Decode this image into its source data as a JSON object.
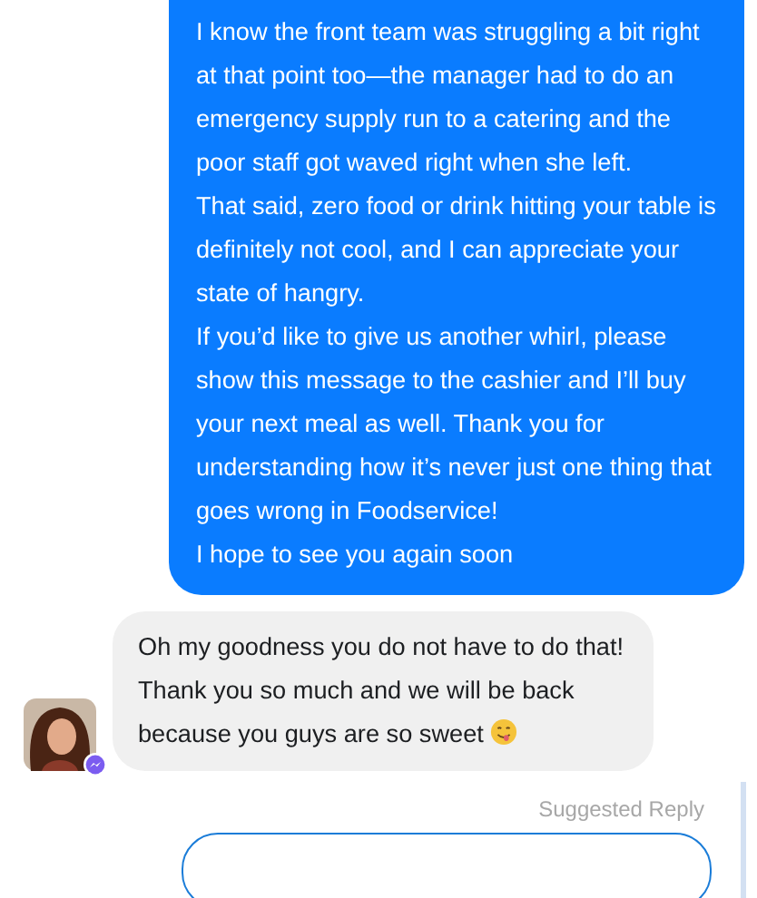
{
  "messages": [
    {
      "kind": "outgoing",
      "paragraphs": [
        "I know the front team was struggling a bit right at that point too—the manager had to do an emergency supply run to a catering and the poor staff got waved right when she left.",
        "That said, zero food or drink hitting your table is definitely not cool, and I can appreciate your state of hangry.",
        "If you’d like to give us another whirl, please show this message to the cashier and I’ll buy your next meal as well. Thank you for understanding how it’s never just one thing that goes wrong in Foodservice!",
        "I hope to see you again soon"
      ]
    },
    {
      "kind": "incoming",
      "paragraphs": [
        "Oh my goodness you do not have to do that! Thank you so much and we will be back because you guys are so sweet"
      ]
    }
  ],
  "suggested_reply": {
    "label": "Suggested Reply"
  }
}
